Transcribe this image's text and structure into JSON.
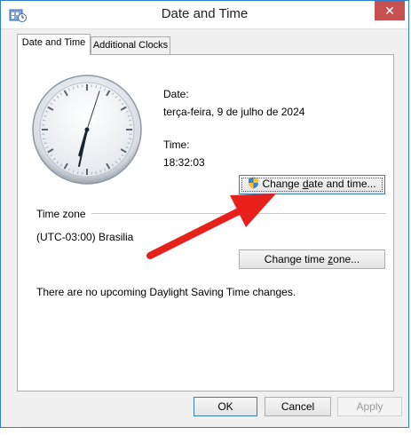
{
  "window": {
    "title": "Date and Time",
    "close_label": "✕"
  },
  "tabs": [
    {
      "label": "Date and Time",
      "active": true
    },
    {
      "label": "Additional Clocks",
      "active": false
    }
  ],
  "date": {
    "label": "Date:",
    "value": "terça-feira, 9 de julho de 2024"
  },
  "time": {
    "label": "Time:",
    "value": "18:32:03"
  },
  "clock": {
    "hour": 18,
    "minute": 32,
    "second": 3
  },
  "change_datetime_button": {
    "label_pre": "Change ",
    "label_accel": "d",
    "label_post": "ate and time..."
  },
  "timezone": {
    "section_label": "Time zone",
    "value": "(UTC-03:00) Brasilia",
    "change_pre": "Change time ",
    "change_accel": "z",
    "change_post": "one..."
  },
  "dst_message": "There are no upcoming Daylight Saving Time changes.",
  "footer": {
    "ok": "OK",
    "cancel": "Cancel",
    "apply": "Apply"
  },
  "colors": {
    "arrow": "#e8201c",
    "close_button": "#c75050",
    "window_border": "#2f7fd1"
  }
}
